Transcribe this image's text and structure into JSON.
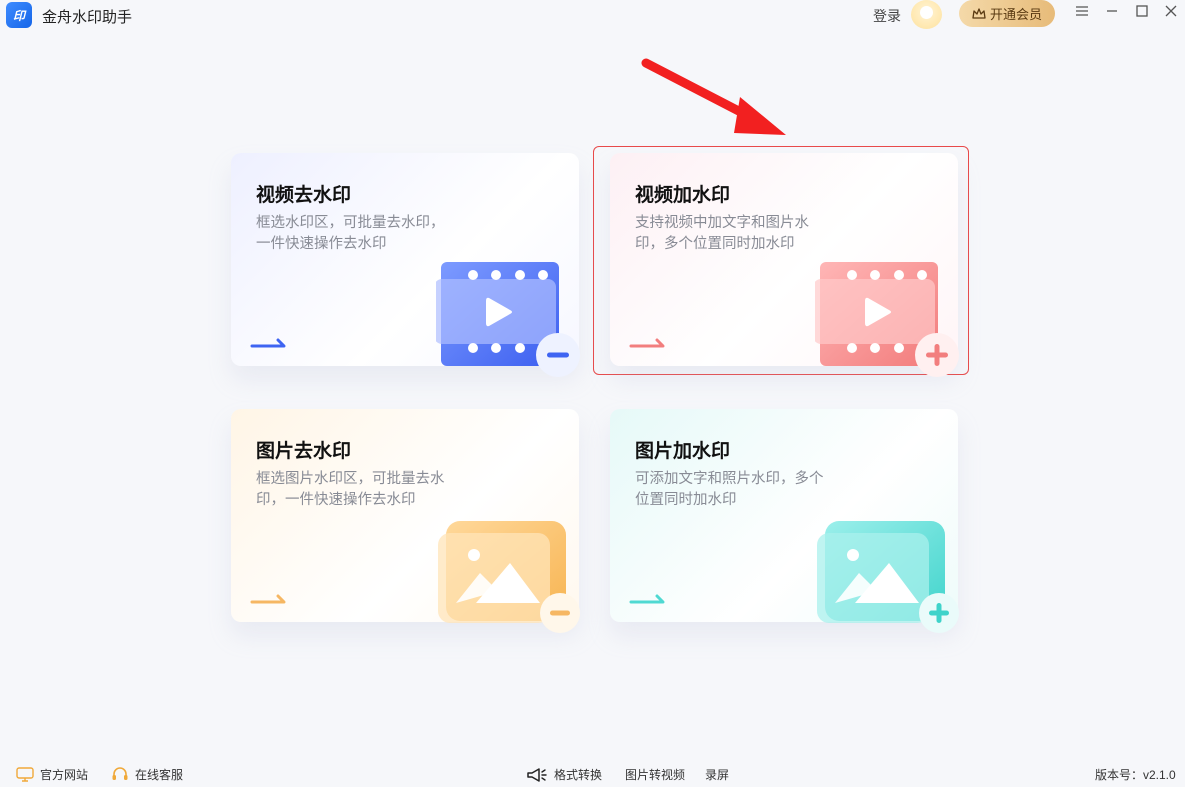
{
  "app": {
    "logo_text": "印",
    "title": "金舟水印助手",
    "login_label": "登录",
    "vip_label": "开通会员"
  },
  "cards": [
    {
      "title": "视频去水印",
      "desc": "框选水印区，可批量去水印，一件快速操作去水印",
      "accent": "#3e64f2"
    },
    {
      "title": "视频加水印",
      "desc": "支持视频中加文字和图片水印，多个位置同时加水印",
      "accent": "#f27e7e"
    },
    {
      "title": "图片去水印",
      "desc": "框选图片水印区，可批量去水印，一件快速操作去水印",
      "accent": "#f6b763"
    },
    {
      "title": "图片加水印",
      "desc": "可添加文字和照片水印，多个位置同时加水印",
      "accent": "#4fd9d2"
    }
  ],
  "footer": {
    "official_site": "官方网站",
    "online_service": "在线客服",
    "format_convert": "格式转换",
    "image_to_video": "图片转视频",
    "screen_record": "录屏",
    "version": "版本号：v2.1.0"
  }
}
